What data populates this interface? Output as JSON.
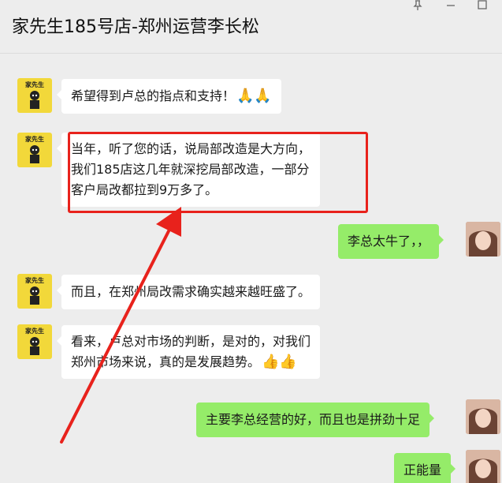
{
  "window": {
    "title": "家先生185号店-郑州运营李长松",
    "pin_icon": "pin-icon",
    "minimize_icon": "minimize-icon",
    "maximize_icon": "maximize-icon"
  },
  "shop_avatar": {
    "brand_text": "家先生"
  },
  "messages": [
    {
      "side": "left",
      "text": "希望得到卢总的指点和支持！",
      "emoji": "🙏🙏"
    },
    {
      "side": "left",
      "lines": [
        "当年，听了您的话，说局部改造是大方向，",
        "我们185店这几年就深挖局部改造，一部分",
        "客户局改都拉到9万多了。"
      ]
    },
    {
      "side": "right",
      "text": "李总太牛了，，"
    },
    {
      "side": "left",
      "text": "而且，在郑州局改需求确实越来越旺盛了。"
    },
    {
      "side": "left",
      "lines": [
        "看来，卢总对市场的判断，是对的，对我们",
        "郑州市场来说，真的是发展趋势。"
      ],
      "emoji": "👍👍"
    },
    {
      "side": "right",
      "text": "主要李总经营的好，而且也是拼劲十足"
    },
    {
      "side": "right",
      "text": "正能量"
    }
  ],
  "annotation": {
    "color": "#e8221c"
  },
  "colors": {
    "bubble_right": "#95ec69",
    "bubble_left": "#ffffff",
    "background": "#ededed"
  }
}
